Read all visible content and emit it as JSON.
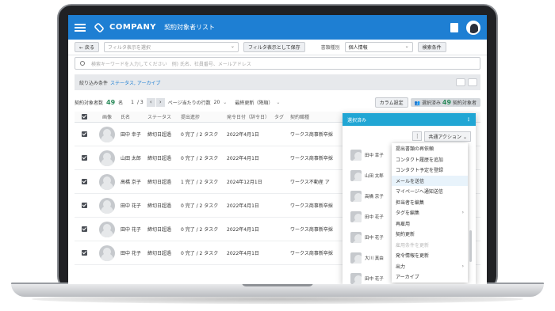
{
  "header": {
    "logo_text": "COMPANY",
    "title": "契約対象者リスト"
  },
  "filterbar": {
    "back_label": "戻る",
    "filter_placeholder": "フィルタ表示を選択",
    "save_filter_label": "フィルタ表示として保存",
    "doc_type_label": "書類種別",
    "doc_type_value": "個人情報",
    "search_cond_label": "検索条件"
  },
  "search": {
    "placeholder": "検索キーワードを入力してください　例) 氏名、社員番号、メールアドレス"
  },
  "conditions": {
    "label": "絞り込み条件",
    "value": "ステータス, アーカイブ"
  },
  "count": {
    "label": "契約対象者数",
    "value": "49",
    "unit": "名",
    "page": "1",
    "pages": "/ 3",
    "per_page_label": "ページ当たりの行数",
    "per_page_value": "20",
    "sort_label": "最終更新（降順）",
    "column_settings": "カラム設定",
    "selected_label": "選択済み",
    "selected_count": "49",
    "selected_unit": "契約対象者"
  },
  "columns": [
    "画像",
    "氏名",
    "ステータス",
    "提出進捗",
    "発令日付（辞令日）",
    "タグ",
    "契約職種"
  ],
  "rows": [
    {
      "name": "田中 幸子",
      "status": "締切日超過",
      "progress": "0 完了 / 2 タスク",
      "date": "2022年4月1日",
      "job": "ワークス商事新卒採"
    },
    {
      "name": "山田 太郎",
      "status": "締切日超過",
      "progress": "0 完了 / 2 タスク",
      "date": "2022年4月1日",
      "job": "ワークス商事新卒採"
    },
    {
      "name": "高橋 京子",
      "status": "締切日超過",
      "progress": "1 完了 / 2 タスク",
      "date": "2024年12月1日",
      "job": "ワークス不動産 ア"
    },
    {
      "name": "田中 花子",
      "status": "締切日超過",
      "progress": "0 完了 / 2 タスク",
      "date": "2022年4月1日",
      "job": "ワークス商事新卒採"
    },
    {
      "name": "田中 花子",
      "status": "締切日超過",
      "progress": "0 完了 / 2 タスク",
      "date": "2022年4月1日",
      "job": "ワークス商事新卒採"
    },
    {
      "name": "田中 花子",
      "status": "締切日超過",
      "progress": "0 完了 / 2 タスク",
      "date": "2022年4月1日",
      "job": "ワークス商事新卒採"
    }
  ],
  "panel": {
    "title": "選択済み",
    "common_action": "共通アクション",
    "people": [
      "田中 幸子",
      "山田 太郎",
      "高橋 京子",
      "田中 花子",
      "田中 花子",
      "大川 真由",
      "田中 花子"
    ],
    "menu": [
      "提出書類の再依頼",
      "コンタクト履歴を追加",
      "コンタクト予定を登録",
      "メールを送信",
      "マイページへ通知送信",
      "担当者を編集",
      "タグを編集",
      "再雇用",
      "契約更新",
      "雇用条件を更新",
      "発令情報を更新",
      "出力",
      "アーカイブ"
    ]
  }
}
